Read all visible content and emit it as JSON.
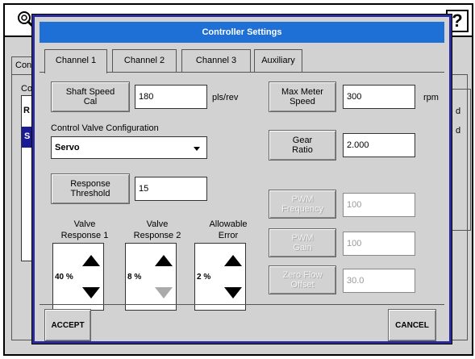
{
  "background": {
    "tab_label": "Con",
    "panel_label": "Co",
    "list_item_r": "R",
    "list_item_s": "S",
    "right_text_1": "d",
    "right_text_2": "d",
    "help_label": "?",
    "logo_icon": "wrench-icon"
  },
  "dialog": {
    "title": "Controller Settings",
    "tabs": [
      {
        "label": "Channel 1",
        "active": true
      },
      {
        "label": "Channel 2",
        "active": false
      },
      {
        "label": "Channel 3",
        "active": false
      },
      {
        "label": "Auxiliary",
        "active": false
      }
    ]
  },
  "shaft_speed": {
    "button_label": "Shaft Speed\nCal",
    "value": "180",
    "unit": "pls/rev"
  },
  "control_valve": {
    "label": "Control Valve Configuration",
    "selected": "Servo"
  },
  "response_threshold": {
    "button_label": "Response\nThreshold",
    "value": "15"
  },
  "spinners": [
    {
      "label": "Valve\nResponse 1",
      "value": "40 %",
      "down_enabled": true
    },
    {
      "label": "Valve\nResponse 2",
      "value": "8 %",
      "down_enabled": false
    },
    {
      "label": "Allowable\nError",
      "value": "2 %",
      "down_enabled": true
    }
  ],
  "max_meter_speed": {
    "button_label": "Max Meter\nSpeed",
    "value": "300",
    "unit": "rpm"
  },
  "gear_ratio": {
    "button_label": "Gear\nRatio",
    "value": "2.000"
  },
  "pwm_frequency": {
    "button_label": "PWM\nFrequency",
    "value": "100"
  },
  "pwm_gain": {
    "button_label": "PWM\nGain",
    "value": "100"
  },
  "zero_flow_offset": {
    "button_label": "Zero Flow\nOffset",
    "value": "30.0"
  },
  "actions": {
    "accept_label": "ACCEPT",
    "cancel_label": "CANCEL"
  },
  "colors": {
    "title_bar": "#1e6fd6",
    "dialog_border": "#2a2a9a",
    "selection": "#1a1a99",
    "panel": "#d2d2d2"
  }
}
